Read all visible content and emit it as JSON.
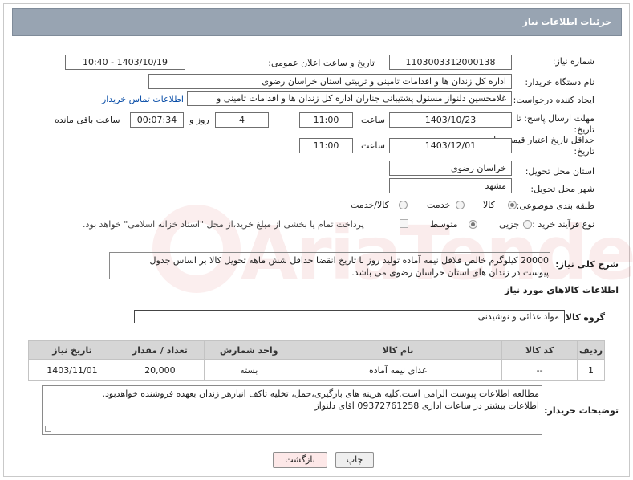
{
  "header": {
    "title": "جزئیات اطلاعات نیاز"
  },
  "form": {
    "need_number": {
      "label": "شماره نیاز:",
      "value": "1103003312000138"
    },
    "announce": {
      "label": "تاریخ و ساعت اعلان عمومی:",
      "value": "1403/10/19 - 10:40"
    },
    "buyer_org": {
      "label": "نام دستگاه خریدار:",
      "value": "اداره کل زندان ها و اقدامات تامینی و تربیتی استان خراسان رضوی"
    },
    "requester": {
      "label": "ایجاد کننده درخواست:",
      "value": "غلامحسین دلنواز مسئول پشتیبانی جناران اداره کل زندان ها و اقدامات تامینی و",
      "contact_link": "اطلاعات تماس خریدار"
    },
    "reply_deadline": {
      "label_line1": "مهلت ارسال پاسخ: تا",
      "label_line2": "تاریخ:",
      "date": "1403/10/23",
      "time_label": "ساعت",
      "time": "11:00",
      "days": "4",
      "days_label": "روز و",
      "remaining": "00:07:34",
      "remaining_label": "ساعت باقی مانده"
    },
    "price_validity": {
      "label_line1": "حداقل تاریخ اعتبار قیمت: تا",
      "label_line2": "تاریخ:",
      "date": "1403/12/01",
      "time_label": "ساعت",
      "time": "11:00"
    },
    "delivery_province": {
      "label": "استان محل تحویل:",
      "value": "خراسان رضوی"
    },
    "delivery_city": {
      "label": "شهر محل تحویل:",
      "value": "مشهد"
    },
    "category": {
      "label": "طبقه بندی موضوعی:",
      "options": [
        "کالا",
        "خدمت",
        "کالا/خدمت"
      ],
      "selected": "کالا"
    },
    "purchase_type": {
      "label": "نوع فرآیند خرید :",
      "options": [
        "جزیی",
        "متوسط"
      ],
      "selected": "متوسط",
      "payment_note": "پرداخت تمام یا بخشی از مبلغ خرید،از محل \"اسناد خزانه اسلامی\" خواهد بود."
    },
    "description": {
      "label": "شرح کلی نیاز:",
      "line1": "20000 کیلوگرم خالص فلافل نیمه آماده تولید روز با تاریخ انقضا حداقل شش ماهه تحویل کالا بر اساس جدول",
      "line2": "پیوست در زندان های استان خراسان رضوی می باشد."
    }
  },
  "goods": {
    "section_title": "اطلاعات کالاهای مورد نیاز",
    "group_label": "گروه کالا:",
    "group_value": "مواد غذائی و نوشیدنی",
    "columns": [
      "ردیف",
      "کد کالا",
      "نام کالا",
      "واحد شمارش",
      "تعداد / مقدار",
      "تاریخ نیاز"
    ],
    "rows": [
      {
        "index": "1",
        "code": "--",
        "name": "غذای نیمه آماده",
        "unit": "بسته",
        "qty": "20,000",
        "date": "1403/11/01"
      }
    ]
  },
  "buyer_notes": {
    "label": "توضیحات خریدار:",
    "line1": "مطالعه اطلاعات پیوست الزامی است.کلیه هزینه های بارگیری،حمل، تخلیه تاکف انبارهر زندان بعهده فروشنده خواهدبود.",
    "line2": "اطلاعات بیشتر در ساعات اداری 09372761258 آقای دلنواز"
  },
  "actions": {
    "print": "چاپ",
    "back": "بازگشت"
  },
  "watermark": "AriaTender.net",
  "colors": {
    "header_bg": "#98a4b2",
    "link": "#0b4fa8",
    "table_header": "#d6d6d6",
    "back_button_bg": "#fde8e8"
  }
}
